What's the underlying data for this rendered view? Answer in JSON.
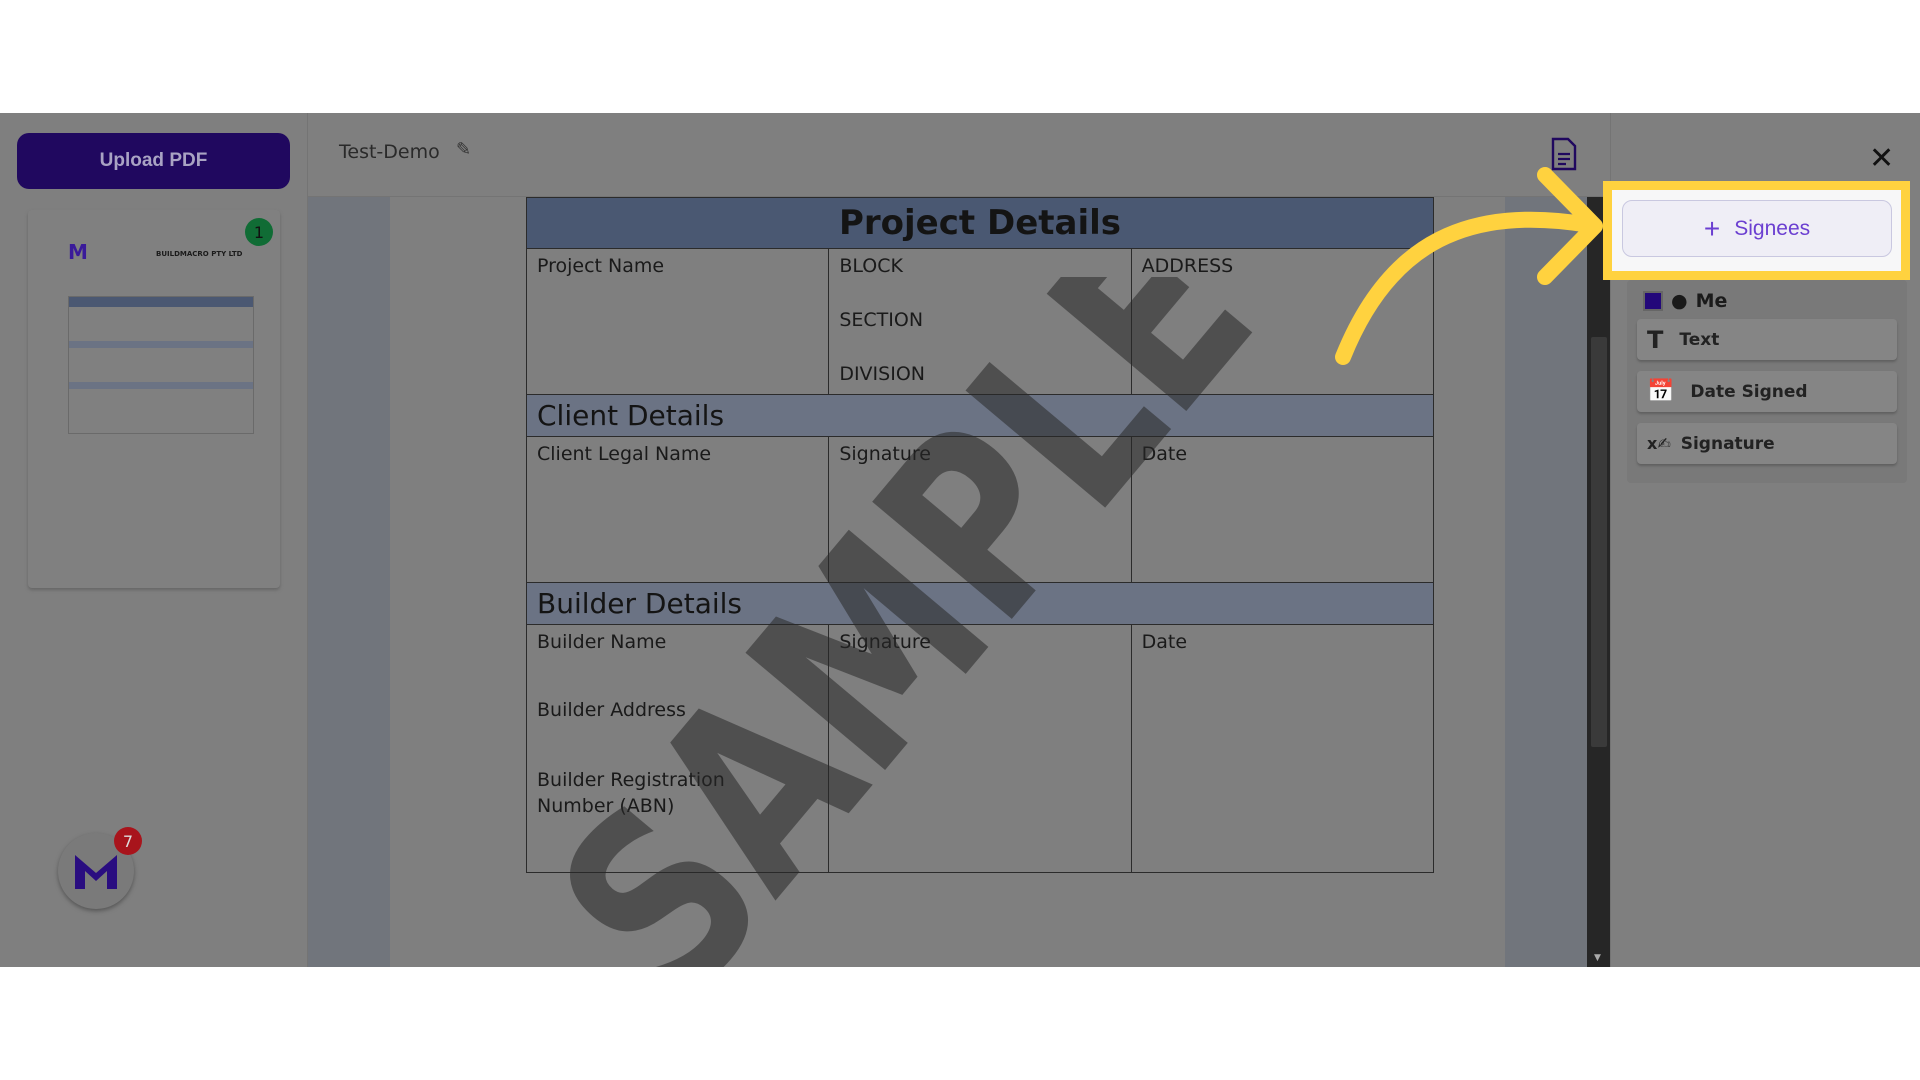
{
  "sidebar": {
    "upload_label": "Upload PDF",
    "thumbnail_page": "1",
    "thumbnail_company": "BUILDMACRO PTY LTD"
  },
  "header": {
    "title": "Test-Demo"
  },
  "document": {
    "watermark": "SAMPLE",
    "project": {
      "heading": "Project Details",
      "col1": [
        "Project Name"
      ],
      "col2": [
        "BLOCK",
        "SECTION",
        "DIVISION"
      ],
      "col3": [
        "ADDRESS"
      ]
    },
    "client": {
      "heading": "Client Details",
      "col1": "Client Legal Name",
      "col2": "Signature",
      "col3": "Date"
    },
    "builder": {
      "heading": "Builder Details",
      "col1": [
        "Builder Name",
        "Builder Address",
        "Builder Registration Number (ABN)"
      ],
      "col2": "Signature",
      "col3": "Date"
    }
  },
  "panel": {
    "signees_label": "Signees",
    "me_label": "Me",
    "tools": [
      "Text",
      "Date Signed",
      "Signature"
    ]
  },
  "fab": {
    "badge": "7"
  },
  "colors": {
    "highlight": "#ffd23f",
    "brand": "#20085f",
    "accent": "#6b3fd1"
  }
}
